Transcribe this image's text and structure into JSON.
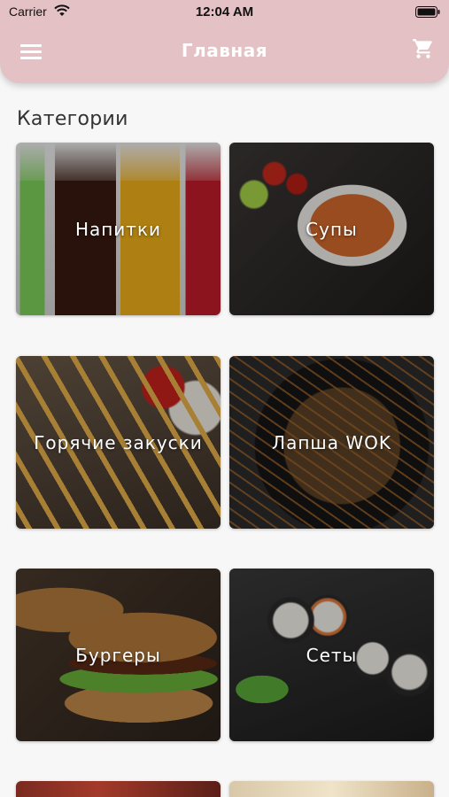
{
  "status_bar": {
    "carrier": "Carrier",
    "time": "12:04 AM"
  },
  "nav": {
    "title": "Главная",
    "menu_icon": "hamburger-menu-icon",
    "cart_icon": "shopping-cart-icon"
  },
  "section_title": "Категории",
  "categories": [
    {
      "label": "Напитки"
    },
    {
      "label": "Супы"
    },
    {
      "label": "Горячие закуски"
    },
    {
      "label": "Лапша WOK"
    },
    {
      "label": "Бургеры"
    },
    {
      "label": "Сеты"
    }
  ],
  "colors": {
    "header": "#e3c1c4",
    "background": "#f7f7f7",
    "title_text": "#333333"
  }
}
